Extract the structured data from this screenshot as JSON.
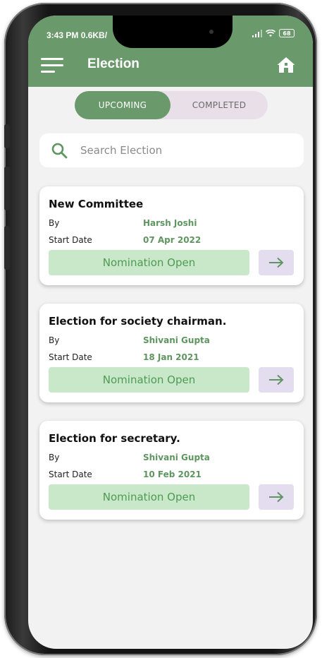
{
  "status_bar": {
    "time": "3:43 PM",
    "speed": "0.6KB/",
    "battery": "68"
  },
  "header": {
    "title": "Election",
    "menu_icon": "hamburger-menu-icon",
    "home_icon": "home-icon"
  },
  "tabs": [
    {
      "label": "UPCOMING",
      "active": true
    },
    {
      "label": "COMPLETED",
      "active": false
    }
  ],
  "search": {
    "placeholder": "Search Election",
    "value": ""
  },
  "labels": {
    "by": "By",
    "start_date": "Start Date"
  },
  "elections": [
    {
      "title": "New Committee",
      "by": "Harsh Joshi",
      "start_date": "07 Apr 2022",
      "status": "Nomination Open"
    },
    {
      "title": "Election for society chairman.",
      "by": "Shivani Gupta",
      "start_date": "18 Jan 2021",
      "status": "Nomination Open"
    },
    {
      "title": "Election for secretary.",
      "by": "Shivani Gupta",
      "start_date": "10 Feb 2021",
      "status": "Nomination Open"
    }
  ],
  "colors": {
    "primary": "#6a9a6b",
    "value_text": "#5f9560",
    "status_bg": "#c9e8c9",
    "arrow_bg": "#e4dcef",
    "tab_track": "#e9dfe9"
  }
}
